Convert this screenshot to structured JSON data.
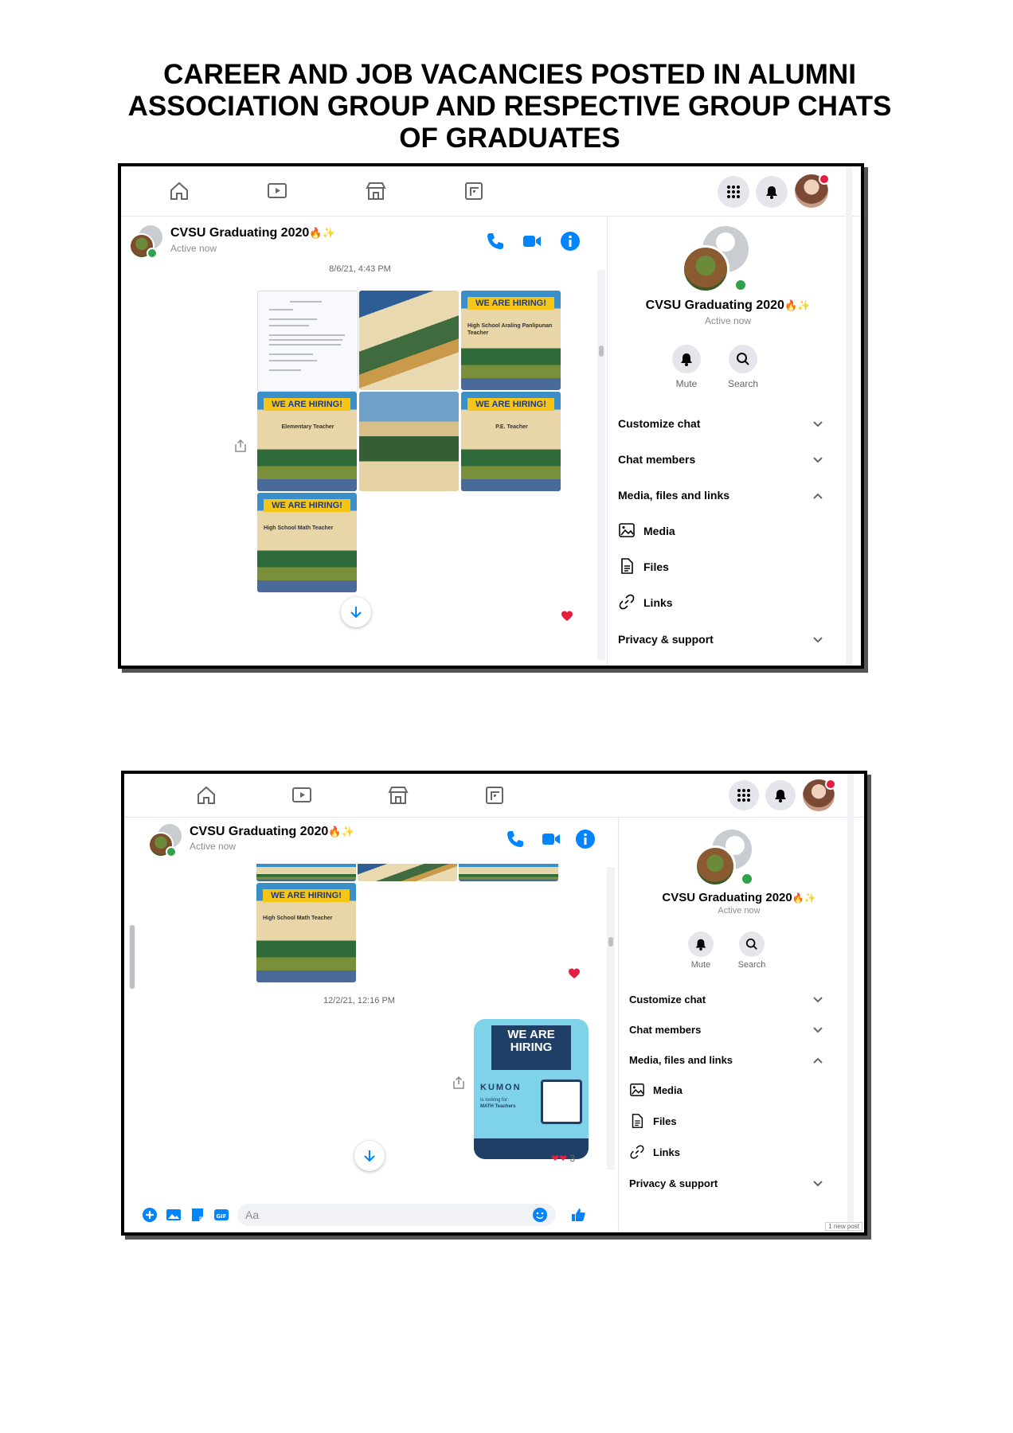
{
  "heading": {
    "line1": "CAREER AND JOB VACANCIES POSTED IN ALUMNI",
    "line2": "ASSOCIATION GROUP AND RESPECTIVE GROUP CHATS",
    "line3": "OF GRADUATES"
  },
  "colors": {
    "accent": "#0084ff",
    "online": "#31a24c",
    "heart": "#e41e3f"
  },
  "icons": [
    "home-icon",
    "watch-icon",
    "marketplace-icon",
    "gaming-icon",
    "menu-grid-icon",
    "notifications-icon",
    "phone-icon",
    "video-icon",
    "info-icon",
    "bell-icon",
    "search-icon",
    "media-icon",
    "files-icon",
    "links-icon",
    "chevron-down-icon",
    "chevron-up-icon",
    "share-icon",
    "arrow-down-icon",
    "heart-icon",
    "plus-icon",
    "image-icon",
    "sticker-icon",
    "gif-icon",
    "emoji-icon",
    "like-icon"
  ],
  "shot1": {
    "chat": {
      "name": "CVSU Graduating 2020",
      "emoji": "🔥✨",
      "status": "Active now"
    },
    "timestamp": "8/6/21, 4:43 PM",
    "tiles": [
      {
        "kind": "doc"
      },
      {
        "kind": "brochure"
      },
      {
        "kind": "hiring",
        "banner": "WE ARE HIRING!",
        "sub": "High School Araling Panlipunan Teacher"
      },
      {
        "kind": "hiring",
        "banner": "WE ARE HIRING!",
        "sub": "Elementary Teacher"
      },
      {
        "kind": "campus"
      },
      {
        "kind": "hiring",
        "banner": "WE ARE HIRING!",
        "sub": "P.E. Teacher"
      },
      {
        "kind": "hiring",
        "banner": "WE ARE HIRING!",
        "sub": "High School Math Teacher"
      }
    ],
    "panel": {
      "name": "CVSU Graduating 2020",
      "emoji": "🔥✨",
      "status": "Active now",
      "mute": "Mute",
      "search": "Search",
      "customize": "Customize chat",
      "members": "Chat members",
      "media_files": "Media, files and links",
      "media": "Media",
      "files": "Files",
      "links": "Links",
      "privacy": "Privacy & support"
    }
  },
  "shot2": {
    "chat": {
      "name": "CVSU Graduating 2020",
      "emoji": "🔥✨",
      "status": "Active now"
    },
    "tile": {
      "banner": "WE ARE HIRING!",
      "sub": "High School Math Teacher"
    },
    "timestamp": "12/2/21, 12:16 PM",
    "kumon": {
      "headline": "WE ARE HIRING",
      "brand": "KUMON",
      "looking": "Is looking for:",
      "role": "MATH Teachers"
    },
    "reaction_count": "3",
    "composer_placeholder": "Aa",
    "new_post": "1 new post",
    "panel": {
      "name": "CVSU Graduating 2020",
      "emoji": "🔥✨",
      "status": "Active now",
      "mute": "Mute",
      "search": "Search",
      "customize": "Customize chat",
      "members": "Chat members",
      "media_files": "Media, files and links",
      "media": "Media",
      "files": "Files",
      "links": "Links",
      "privacy": "Privacy & support"
    }
  }
}
